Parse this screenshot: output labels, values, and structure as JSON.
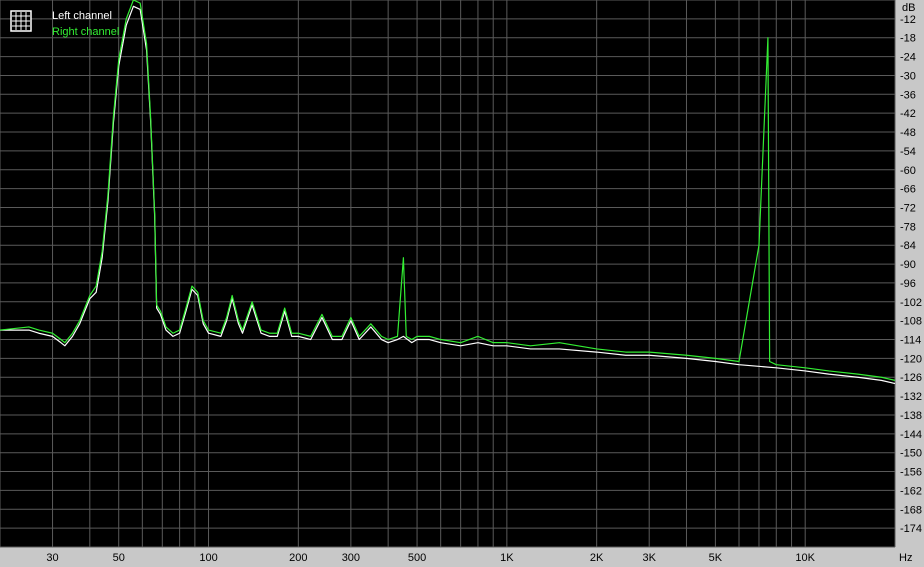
{
  "chart_data": {
    "type": "line",
    "title": "",
    "xlabel": "",
    "ylabel": "",
    "x_scale": "log",
    "xlim": [
      20,
      20000
    ],
    "ylim": [
      -180,
      -6
    ],
    "y_unit": "dB",
    "x_unit": "Hz",
    "grid": true,
    "legend_position": "top-left",
    "x_tick_labels": [
      {
        "value": 30,
        "label": "30"
      },
      {
        "value": 50,
        "label": "50"
      },
      {
        "value": 100,
        "label": "100"
      },
      {
        "value": 200,
        "label": "200"
      },
      {
        "value": 300,
        "label": "300"
      },
      {
        "value": 500,
        "label": "500"
      },
      {
        "value": 1000,
        "label": "1K"
      },
      {
        "value": 2000,
        "label": "2K"
      },
      {
        "value": 3000,
        "label": "3K"
      },
      {
        "value": 5000,
        "label": "5K"
      },
      {
        "value": 10000,
        "label": "10K"
      }
    ],
    "y_ticks": [
      -12,
      -18,
      -24,
      -30,
      -36,
      -42,
      -48,
      -54,
      -60,
      -66,
      -72,
      -78,
      -84,
      -90,
      -96,
      -102,
      -108,
      -114,
      -120,
      -126,
      -132,
      -138,
      -144,
      -150,
      -156,
      -162,
      -168,
      -174
    ],
    "series": [
      {
        "name": "Left channel",
        "color": "#ffffff",
        "points": [
          [
            20,
            -111
          ],
          [
            25,
            -111
          ],
          [
            27,
            -112
          ],
          [
            30,
            -113
          ],
          [
            32,
            -115
          ],
          [
            33,
            -116
          ],
          [
            35,
            -113
          ],
          [
            37,
            -109
          ],
          [
            40,
            -101
          ],
          [
            42,
            -99
          ],
          [
            44,
            -88
          ],
          [
            46,
            -70
          ],
          [
            48,
            -45
          ],
          [
            50,
            -27
          ],
          [
            53,
            -14
          ],
          [
            56,
            -8
          ],
          [
            59,
            -9
          ],
          [
            62,
            -22
          ],
          [
            64,
            -45
          ],
          [
            66,
            -75
          ],
          [
            67,
            -104
          ],
          [
            69,
            -106
          ],
          [
            72,
            -111
          ],
          [
            76,
            -113
          ],
          [
            80,
            -112
          ],
          [
            84,
            -105
          ],
          [
            88,
            -98
          ],
          [
            92,
            -100
          ],
          [
            96,
            -109
          ],
          [
            100,
            -112
          ],
          [
            110,
            -113
          ],
          [
            115,
            -108
          ],
          [
            120,
            -101
          ],
          [
            126,
            -109
          ],
          [
            130,
            -112
          ],
          [
            140,
            -103
          ],
          [
            150,
            -112
          ],
          [
            160,
            -113
          ],
          [
            170,
            -113
          ],
          [
            180,
            -105
          ],
          [
            190,
            -113
          ],
          [
            200,
            -113
          ],
          [
            220,
            -114
          ],
          [
            240,
            -107
          ],
          [
            260,
            -114
          ],
          [
            280,
            -114
          ],
          [
            300,
            -108
          ],
          [
            320,
            -114
          ],
          [
            350,
            -110
          ],
          [
            380,
            -114
          ],
          [
            400,
            -115
          ],
          [
            430,
            -114
          ],
          [
            450,
            -113
          ],
          [
            480,
            -115
          ],
          [
            500,
            -114
          ],
          [
            550,
            -114
          ],
          [
            600,
            -115
          ],
          [
            700,
            -116
          ],
          [
            800,
            -115
          ],
          [
            900,
            -116
          ],
          [
            1000,
            -116
          ],
          [
            1200,
            -117
          ],
          [
            1500,
            -117
          ],
          [
            2000,
            -118
          ],
          [
            2500,
            -119
          ],
          [
            3000,
            -119
          ],
          [
            4000,
            -120
          ],
          [
            5000,
            -121
          ],
          [
            6000,
            -122
          ],
          [
            8000,
            -123
          ],
          [
            10000,
            -124
          ],
          [
            12000,
            -125
          ],
          [
            15000,
            -126
          ],
          [
            18000,
            -127
          ],
          [
            20000,
            -128
          ]
        ]
      },
      {
        "name": "Right channel",
        "color": "#33ee33",
        "points": [
          [
            20,
            -111
          ],
          [
            25,
            -110
          ],
          [
            27,
            -111
          ],
          [
            30,
            -112
          ],
          [
            32,
            -114
          ],
          [
            33,
            -115
          ],
          [
            35,
            -112
          ],
          [
            37,
            -108
          ],
          [
            40,
            -100
          ],
          [
            42,
            -97
          ],
          [
            44,
            -86
          ],
          [
            46,
            -68
          ],
          [
            48,
            -43
          ],
          [
            50,
            -25
          ],
          [
            53,
            -12
          ],
          [
            56,
            -6
          ],
          [
            59,
            -7
          ],
          [
            62,
            -20
          ],
          [
            64,
            -44
          ],
          [
            66,
            -74
          ],
          [
            67,
            -103
          ],
          [
            69,
            -105
          ],
          [
            72,
            -110
          ],
          [
            76,
            -112
          ],
          [
            80,
            -111
          ],
          [
            84,
            -104
          ],
          [
            88,
            -97
          ],
          [
            92,
            -99
          ],
          [
            96,
            -108
          ],
          [
            100,
            -111
          ],
          [
            110,
            -112
          ],
          [
            115,
            -107
          ],
          [
            120,
            -100
          ],
          [
            126,
            -108
          ],
          [
            130,
            -111
          ],
          [
            140,
            -102
          ],
          [
            150,
            -111
          ],
          [
            160,
            -112
          ],
          [
            170,
            -112
          ],
          [
            180,
            -104
          ],
          [
            190,
            -112
          ],
          [
            200,
            -112
          ],
          [
            220,
            -113
          ],
          [
            240,
            -106
          ],
          [
            260,
            -113
          ],
          [
            280,
            -113
          ],
          [
            300,
            -107
          ],
          [
            320,
            -113
          ],
          [
            350,
            -109
          ],
          [
            380,
            -113
          ],
          [
            400,
            -114
          ],
          [
            430,
            -113
          ],
          [
            450,
            -88
          ],
          [
            460,
            -113
          ],
          [
            480,
            -114
          ],
          [
            500,
            -113
          ],
          [
            550,
            -113
          ],
          [
            600,
            -114
          ],
          [
            700,
            -115
          ],
          [
            800,
            -113
          ],
          [
            900,
            -115
          ],
          [
            1000,
            -115
          ],
          [
            1200,
            -116
          ],
          [
            1500,
            -115
          ],
          [
            2000,
            -117
          ],
          [
            2500,
            -118
          ],
          [
            3000,
            -118
          ],
          [
            4000,
            -119
          ],
          [
            5000,
            -120
          ],
          [
            6000,
            -121
          ],
          [
            7000,
            -84
          ],
          [
            7500,
            -18
          ],
          [
            7600,
            -121
          ],
          [
            8000,
            -122
          ],
          [
            10000,
            -123
          ],
          [
            12000,
            -124
          ],
          [
            15000,
            -125
          ],
          [
            18000,
            -126
          ],
          [
            20000,
            -127
          ]
        ]
      }
    ]
  }
}
